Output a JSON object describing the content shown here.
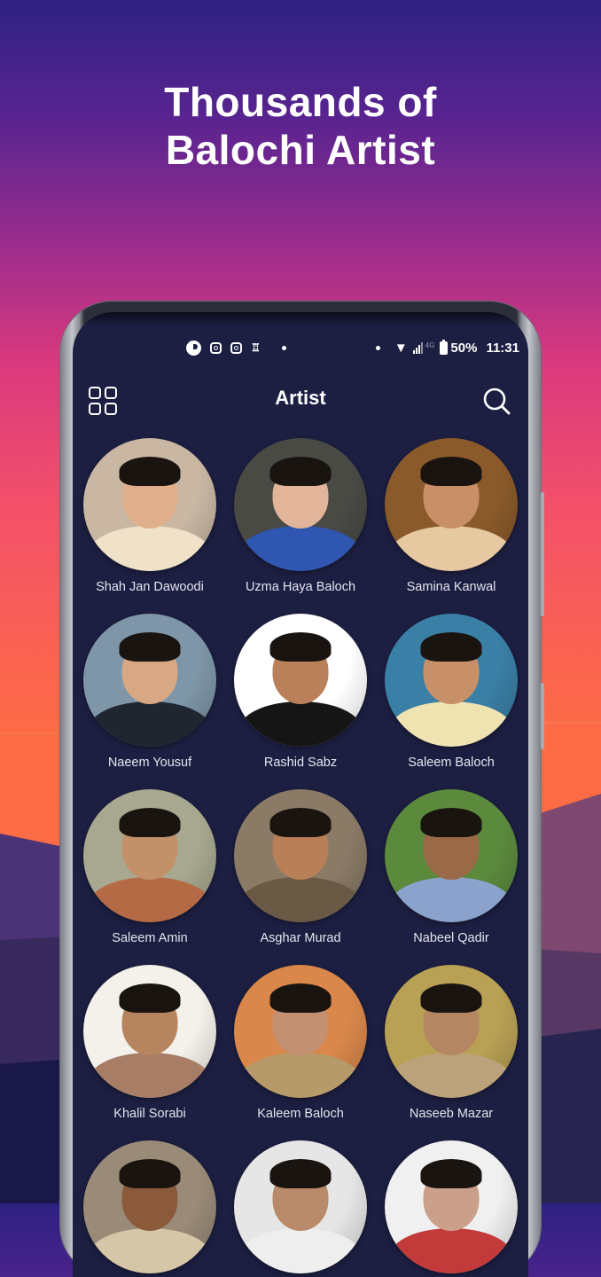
{
  "promo": {
    "headline_line1": "Thousands of",
    "headline_line2": "Balochi Artist"
  },
  "statusbar": {
    "left_icons": [
      "app-circle-icon",
      "instagram-icon",
      "instagram-icon",
      "sim-tower-icon",
      "dot"
    ],
    "right_icons": [
      "dot",
      "wifi-icon",
      "signal-icon",
      "battery-icon"
    ],
    "network": "4G",
    "battery": "50%",
    "time": "11:31"
  },
  "appbar": {
    "title": "Artist",
    "left_icon": "grid-menu-icon",
    "right_icon": "search-icon"
  },
  "artists": [
    {
      "name": "Shah Jan Dawoodi",
      "bg": "#c9b7a3",
      "skin": "#e0b08c",
      "cloth": "#efe2c8"
    },
    {
      "name": "Uzma Haya Baloch",
      "bg": "#4a4a45",
      "skin": "#e2b49a",
      "cloth": "#2f56b0"
    },
    {
      "name": "Samina Kanwal",
      "bg": "#8a5a2a",
      "skin": "#c98f66",
      "cloth": "#e6c9a0"
    },
    {
      "name": "Naeem Yousuf",
      "bg": "#7e96a8",
      "skin": "#d7a883",
      "cloth": "#1f2630"
    },
    {
      "name": "Rashid Sabz",
      "bg": "#ffffff",
      "skin": "#b9805a",
      "cloth": "#151515"
    },
    {
      "name": "Saleem Baloch",
      "bg": "#3a7fa6",
      "skin": "#c89068",
      "cloth": "#f0e3b2"
    },
    {
      "name": "Saleem Amin",
      "bg": "#a7a88f",
      "skin": "#c2916a",
      "cloth": "#b46a44"
    },
    {
      "name": "Asghar Murad",
      "bg": "#8a7a66",
      "skin": "#b98057",
      "cloth": "#6a5a45"
    },
    {
      "name": "Nabeel Qadir",
      "bg": "#5b8a3d",
      "skin": "#9a6a48",
      "cloth": "#8aa2cc"
    },
    {
      "name": "Khalil Sorabi",
      "bg": "#f4f1ea",
      "skin": "#b6855f",
      "cloth": "#a77d66"
    },
    {
      "name": "Kaleem Baloch",
      "bg": "#d9874a",
      "skin": "#c49072",
      "cloth": "#b79a6a"
    },
    {
      "name": "Naseeb Mazar",
      "bg": "#b8a055",
      "skin": "#b48662",
      "cloth": "#bca27a"
    },
    {
      "name": "",
      "bg": "#9a8a78",
      "skin": "#8a5a3a",
      "cloth": "#d6c6a8"
    },
    {
      "name": "",
      "bg": "#e6e6e6",
      "skin": "#b98a6a",
      "cloth": "#eeeeee"
    },
    {
      "name": "",
      "bg": "#f0f0f0",
      "skin": "#caa08a",
      "cloth": "#c23a3a"
    }
  ],
  "colors": {
    "screen_bg": "#1d1f42",
    "text": "#ffffff",
    "name_text": "#e4e5ee"
  }
}
